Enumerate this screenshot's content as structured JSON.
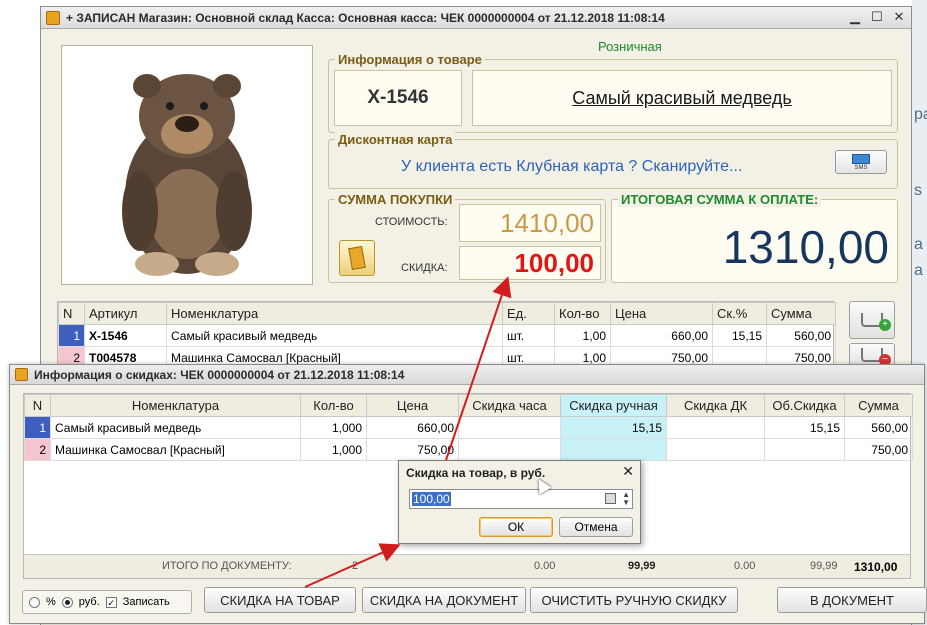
{
  "background": {
    "fragments": [
      "ра",
      "s",
      "а",
      "а"
    ]
  },
  "main_window": {
    "title": "+ ЗАПИСАН Магазин: Основной склад Касса: Основная касса: ЧЕК 0000000004 от 21.12.2018 11:08:14",
    "price_type": "Розничная",
    "product_info": {
      "title": "Информация о товаре",
      "sku": "Х-1546",
      "name": "Самый красивый медведь"
    },
    "discount_card": {
      "title": "Дисконтная карта",
      "prompt": "У клиента есть Клубная карта ? Сканируйте...",
      "sms_label": "SMS"
    },
    "purchase_sum": {
      "title": "СУММА ПОКУПКИ",
      "cost_label": "СТОИМОСТЬ:",
      "cost_value": "1410,00",
      "discount_label": "СКИДКА:",
      "discount_value": "100,00"
    },
    "total_to_pay": {
      "title": "ИТОГОВАЯ СУММА К ОПЛАТЕ:",
      "value": "1310,00"
    },
    "table": {
      "headers": [
        "N",
        "Артикул",
        "Номенклатура",
        "Ед.",
        "Кол-во",
        "Цена",
        "Ск.%",
        "Сумма"
      ],
      "rows": [
        [
          "1",
          "Х-1546",
          "Самый красивый медведь",
          "шт.",
          "1,00",
          "660,00",
          "15,15",
          "560,00"
        ],
        [
          "2",
          "Т004578",
          "Машинка Самосвал [Красный]",
          "шт.",
          "1,00",
          "750,00",
          "",
          "750,00"
        ]
      ]
    }
  },
  "discount_window": {
    "title": "Информация о скидках: ЧЕК 0000000004 от 21.12.2018 11:08:14",
    "table": {
      "headers": [
        "N",
        "Номенклатура",
        "Кол-во",
        "Цена",
        "Скидка часа",
        "Скидка ручная",
        "Скидка ДК",
        "Об.Скидка",
        "Сумма"
      ],
      "rows": [
        [
          "1",
          "Самый красивый медведь",
          "1,000",
          "660,00",
          "",
          "15,15",
          "",
          "15,15",
          "560,00"
        ],
        [
          "2",
          "Машинка Самосвал [Красный]",
          "1,000",
          "750,00",
          "",
          "",
          "",
          "",
          "750,00"
        ]
      ],
      "footer": {
        "label": "ИТОГО ПО ДОКУМЕНТУ:",
        "qty": "2",
        "hour_discount": "0.00",
        "manual_discount": "99,99",
        "card_discount": "0.00",
        "total_discount": "99,99",
        "sum": "1310,00"
      }
    },
    "options": {
      "percent_label": "%",
      "rub_label": "руб.",
      "save_label": "Записать",
      "selected": "руб.",
      "save_checked": true
    },
    "buttons": {
      "item_discount": "СКИДКА НА ТОВАР",
      "doc_discount": "СКИДКА НА ДОКУМЕНТ",
      "clear_manual": "ОЧИСТИТЬ РУЧНУЮ СКИДКУ",
      "to_document": "В ДОКУМЕНТ"
    }
  },
  "modal": {
    "title": "Скидка на товар, в руб.",
    "value": "100,00",
    "ok": "ОК",
    "cancel": "Отмена"
  },
  "colors": {
    "accent_red": "#e21515",
    "total_blue": "#16365e",
    "group_title": "#7a5c12",
    "manual_cell": "#c9f2f8",
    "row1_index": "#3f5fbf",
    "row2_index": "#f5c6cf"
  }
}
